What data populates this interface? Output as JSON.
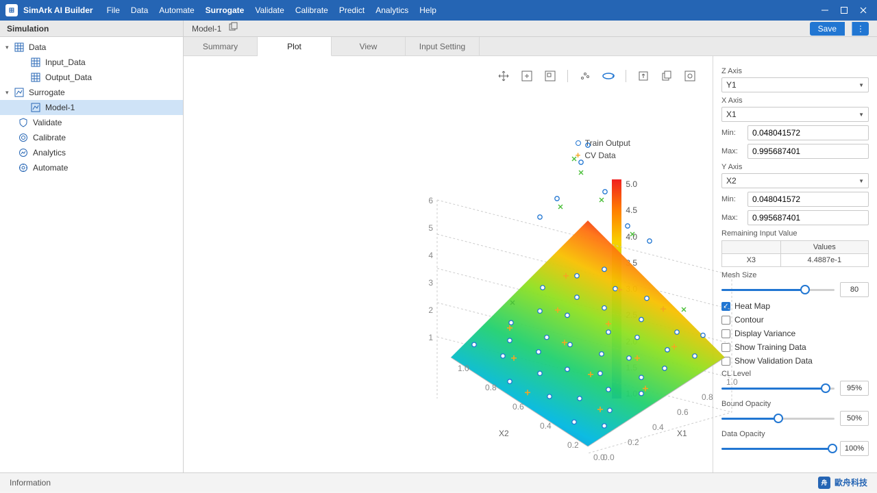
{
  "app": {
    "title": "SimArk AI Builder"
  },
  "menubar": [
    "File",
    "Data",
    "Automate",
    "Surrogate",
    "Validate",
    "Calibrate",
    "Predict",
    "Analytics",
    "Help"
  ],
  "menubar_active": "Surrogate",
  "sidebar": {
    "header": "Simulation",
    "tree": {
      "data": {
        "label": "Data",
        "children": [
          "Input_Data",
          "Output_Data"
        ]
      },
      "surrogate": {
        "label": "Surrogate",
        "children": [
          "Model-1"
        ]
      },
      "validate": "Validate",
      "calibrate": "Calibrate",
      "analytics": "Analytics",
      "automate": "Automate"
    }
  },
  "doc": {
    "name": "Model-1"
  },
  "save": {
    "label": "Save"
  },
  "tabs": [
    "Summary",
    "Plot",
    "View",
    "Input Setting"
  ],
  "active_tab": "Plot",
  "legend": {
    "train": "Train Output",
    "cv": "CV Data"
  },
  "colorbar": {
    "ticks": [
      "5.0",
      "4.5",
      "4.0",
      "3.5",
      "3.0",
      "2.5",
      "2.0",
      "1.5",
      "1.0"
    ]
  },
  "axes3d": {
    "x": "X1",
    "y": "X2",
    "z": " "
  },
  "panel": {
    "z": {
      "label": "Z Axis",
      "value": "Y1"
    },
    "x": {
      "label": "X Axis",
      "value": "X1",
      "min_label": "Min:",
      "min": "0.048041572",
      "max_label": "Max:",
      "max": "0.995687401"
    },
    "y": {
      "label": "Y Axis",
      "value": "X2",
      "min_label": "Min:",
      "min": "0.048041572",
      "max_label": "Max:",
      "max": "0.995687401"
    },
    "remaining": {
      "label": "Remaining Input Value",
      "header_name": "",
      "header_val": "Values",
      "row_name": "X3",
      "row_val": "4.4887e-1"
    },
    "mesh": {
      "label": "Mesh Size",
      "value": "80",
      "pct": 74
    },
    "checks": {
      "heatmap": "Heat Map",
      "contour": "Contour",
      "variance": "Display Variance",
      "train": "Show Training Data",
      "valid": "Show Validation Data"
    },
    "cl": {
      "label": "CL Level",
      "value": "95%",
      "pct": 92
    },
    "bound": {
      "label": "Bound Opacity",
      "value": "50%",
      "pct": 50
    },
    "dopac": {
      "label": "Data Opacity",
      "value": "100%",
      "pct": 98
    }
  },
  "status": {
    "info": "Information",
    "brand": "歐舟科技"
  },
  "chart_data": {
    "type": "heatmap",
    "title": "",
    "xlabel": "X1",
    "ylabel": "X2",
    "zlabel": "",
    "x_range": [
      0.0,
      1.0
    ],
    "y_range": [
      0.0,
      1.0
    ],
    "z_range": [
      1.0,
      5.0
    ],
    "x_ticks": [
      0.0,
      0.2,
      0.4,
      0.6,
      0.8,
      1.0
    ],
    "y_ticks": [
      0.0,
      0.2,
      0.4,
      0.6,
      0.8,
      1.0
    ],
    "colorbar_ticks": [
      1.0,
      1.5,
      2.0,
      2.5,
      3.0,
      3.5,
      4.0,
      4.5,
      5.0
    ],
    "series": [
      {
        "name": "Train Output",
        "marker": "open-circle",
        "color": "#2176d2",
        "points": [
          [
            0.05,
            0.62
          ],
          [
            0.08,
            0.18
          ],
          [
            0.1,
            0.93
          ],
          [
            0.12,
            0.4
          ],
          [
            0.15,
            0.77
          ],
          [
            0.17,
            0.05
          ],
          [
            0.2,
            0.55
          ],
          [
            0.22,
            0.28
          ],
          [
            0.25,
            0.82
          ],
          [
            0.27,
            0.11
          ],
          [
            0.3,
            0.66
          ],
          [
            0.32,
            0.47
          ],
          [
            0.34,
            0.9
          ],
          [
            0.37,
            0.22
          ],
          [
            0.4,
            0.7
          ],
          [
            0.42,
            0.33
          ],
          [
            0.45,
            0.58
          ],
          [
            0.47,
            0.08
          ],
          [
            0.5,
            0.85
          ],
          [
            0.52,
            0.42
          ],
          [
            0.55,
            0.16
          ],
          [
            0.58,
            0.73
          ],
          [
            0.6,
            0.3
          ],
          [
            0.62,
            0.95
          ],
          [
            0.65,
            0.5
          ],
          [
            0.68,
            0.12
          ],
          [
            0.7,
            0.78
          ],
          [
            0.73,
            0.37
          ],
          [
            0.75,
            0.63
          ],
          [
            0.78,
            0.2
          ],
          [
            0.8,
            0.88
          ],
          [
            0.83,
            0.44
          ],
          [
            0.85,
            0.07
          ],
          [
            0.88,
            0.68
          ],
          [
            0.9,
            0.25
          ],
          [
            0.93,
            0.81
          ],
          [
            0.95,
            0.52
          ],
          [
            0.98,
            0.14
          ]
        ]
      },
      {
        "name": "CV Data",
        "marker": "plus",
        "color": "#f5a623",
        "points": [
          [
            0.06,
            0.5
          ],
          [
            0.18,
            0.72
          ],
          [
            0.24,
            0.15
          ],
          [
            0.31,
            0.88
          ],
          [
            0.38,
            0.36
          ],
          [
            0.44,
            0.61
          ],
          [
            0.51,
            0.09
          ],
          [
            0.57,
            0.79
          ],
          [
            0.63,
            0.27
          ],
          [
            0.69,
            0.54
          ],
          [
            0.76,
            0.92
          ],
          [
            0.82,
            0.19
          ],
          [
            0.89,
            0.66
          ],
          [
            0.96,
            0.41
          ]
        ]
      }
    ],
    "surface_note": "z ≈ f(X1,X2) rising from ~1 at (0,0) edge to ~5 at (1,1) corner, heat-mapped"
  }
}
